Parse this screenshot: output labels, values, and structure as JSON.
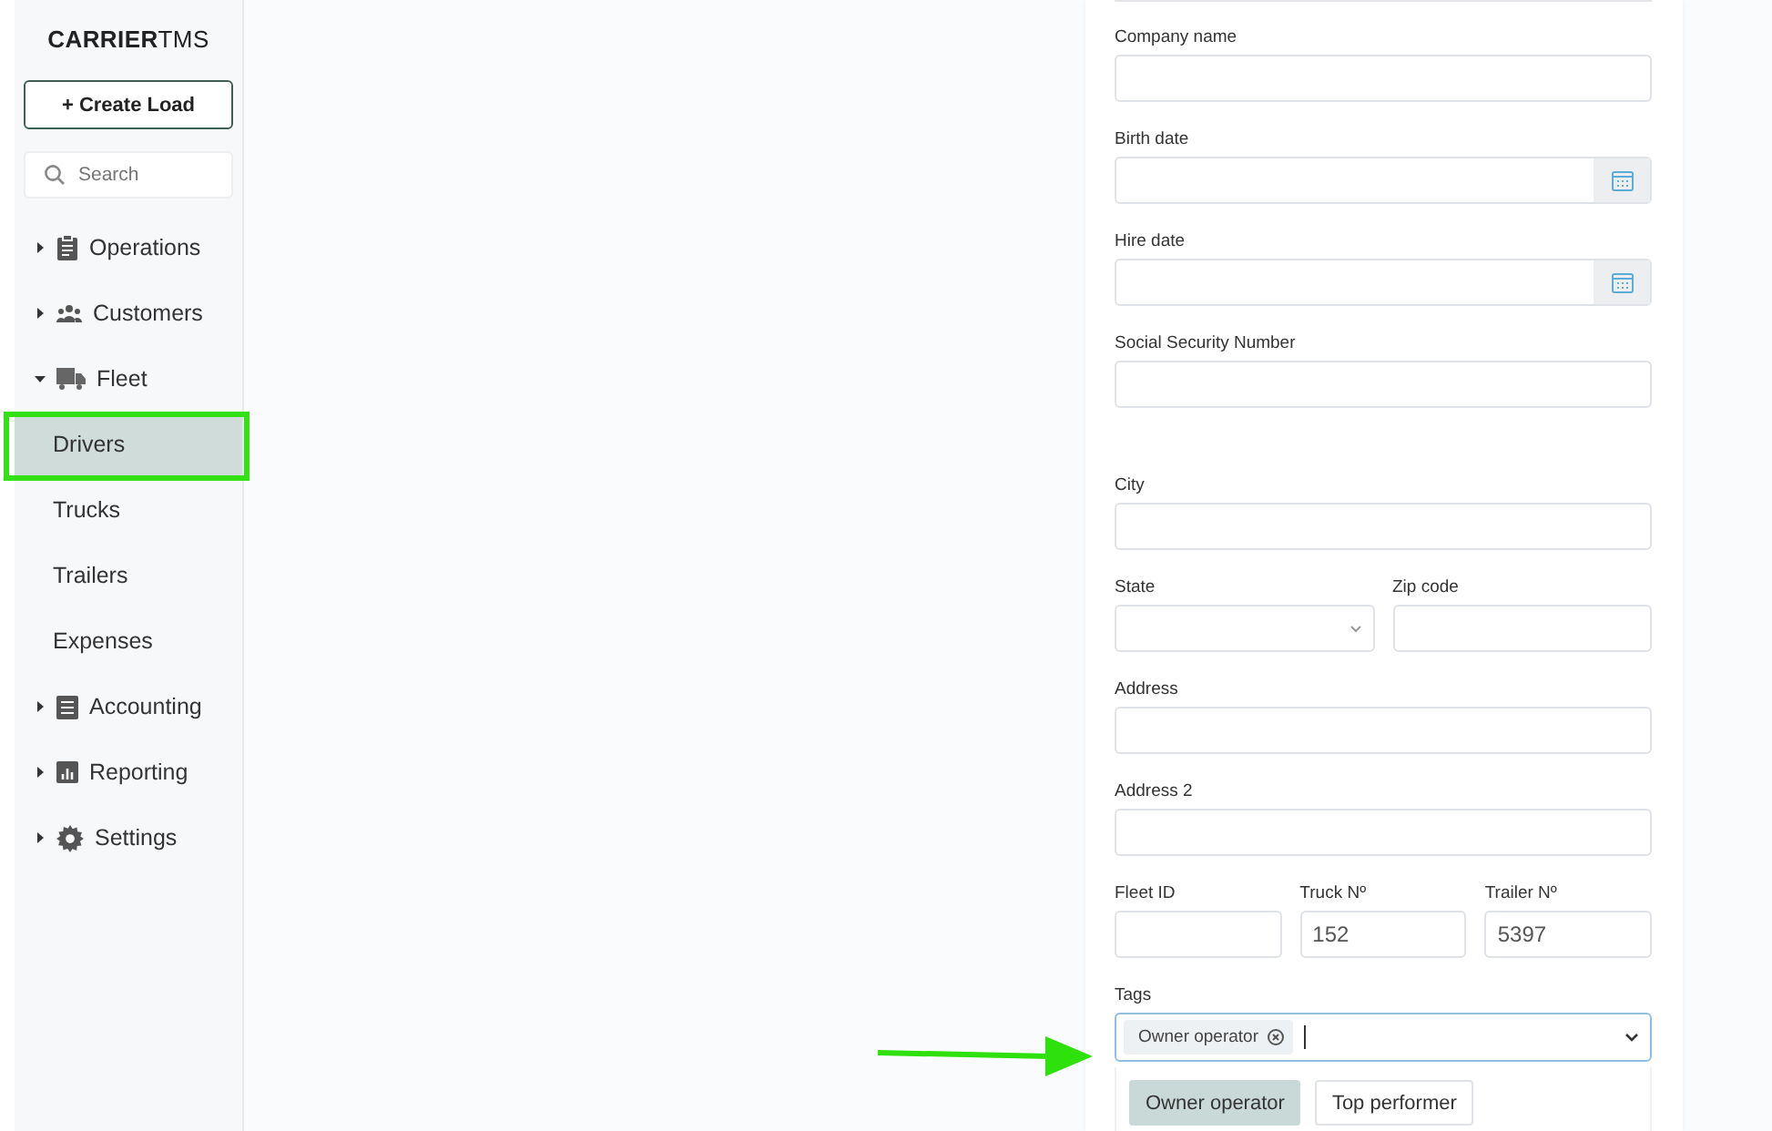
{
  "sidebar": {
    "logo": {
      "bold": "CARRIER",
      "light": "TMS"
    },
    "create_button": "+ Create Load",
    "search": {
      "placeholder": "Search"
    },
    "items": [
      {
        "label": "Operations",
        "expanded": false,
        "selected": false
      },
      {
        "label": "Customers",
        "expanded": false,
        "selected": false
      },
      {
        "label": "Fleet",
        "expanded": true,
        "selected": false,
        "children": [
          {
            "label": "Drivers",
            "selected": true
          },
          {
            "label": "Trucks",
            "selected": false
          },
          {
            "label": "Trailers",
            "selected": false
          },
          {
            "label": "Expenses",
            "selected": false
          }
        ]
      },
      {
        "label": "Accounting",
        "expanded": false,
        "selected": false
      },
      {
        "label": "Reporting",
        "expanded": false,
        "selected": false
      },
      {
        "label": "Settings",
        "expanded": false,
        "selected": false
      }
    ]
  },
  "form": {
    "sections": [
      {
        "rows": [
          [
            {
              "label": "Company name",
              "kind": "text"
            }
          ],
          [
            {
              "label": "Birth date",
              "kind": "date"
            }
          ],
          [
            {
              "label": "Hire date",
              "kind": "date"
            }
          ],
          [
            {
              "label": "Social Security Number",
              "kind": "text"
            }
          ]
        ]
      },
      {
        "rows": [
          [
            {
              "label": "City",
              "kind": "text"
            }
          ],
          [
            {
              "label": "State",
              "kind": "select"
            },
            {
              "label": "Zip code",
              "kind": "text"
            }
          ],
          [
            {
              "label": "Address",
              "kind": "text"
            }
          ],
          [
            {
              "label": "Address 2",
              "kind": "text"
            }
          ],
          [
            {
              "label": "Fleet ID",
              "kind": "text"
            },
            {
              "label": "Truck Nº",
              "kind": "text",
              "value": "152"
            },
            {
              "label": "Trailer Nº",
              "kind": "text",
              "value": "5397"
            }
          ]
        ]
      }
    ],
    "tags": {
      "label": "Tags",
      "chips": [
        "Owner operator"
      ],
      "options": [
        {
          "label": "Owner operator",
          "selected": true
        },
        {
          "label": "Top performer",
          "selected": false
        }
      ]
    }
  }
}
